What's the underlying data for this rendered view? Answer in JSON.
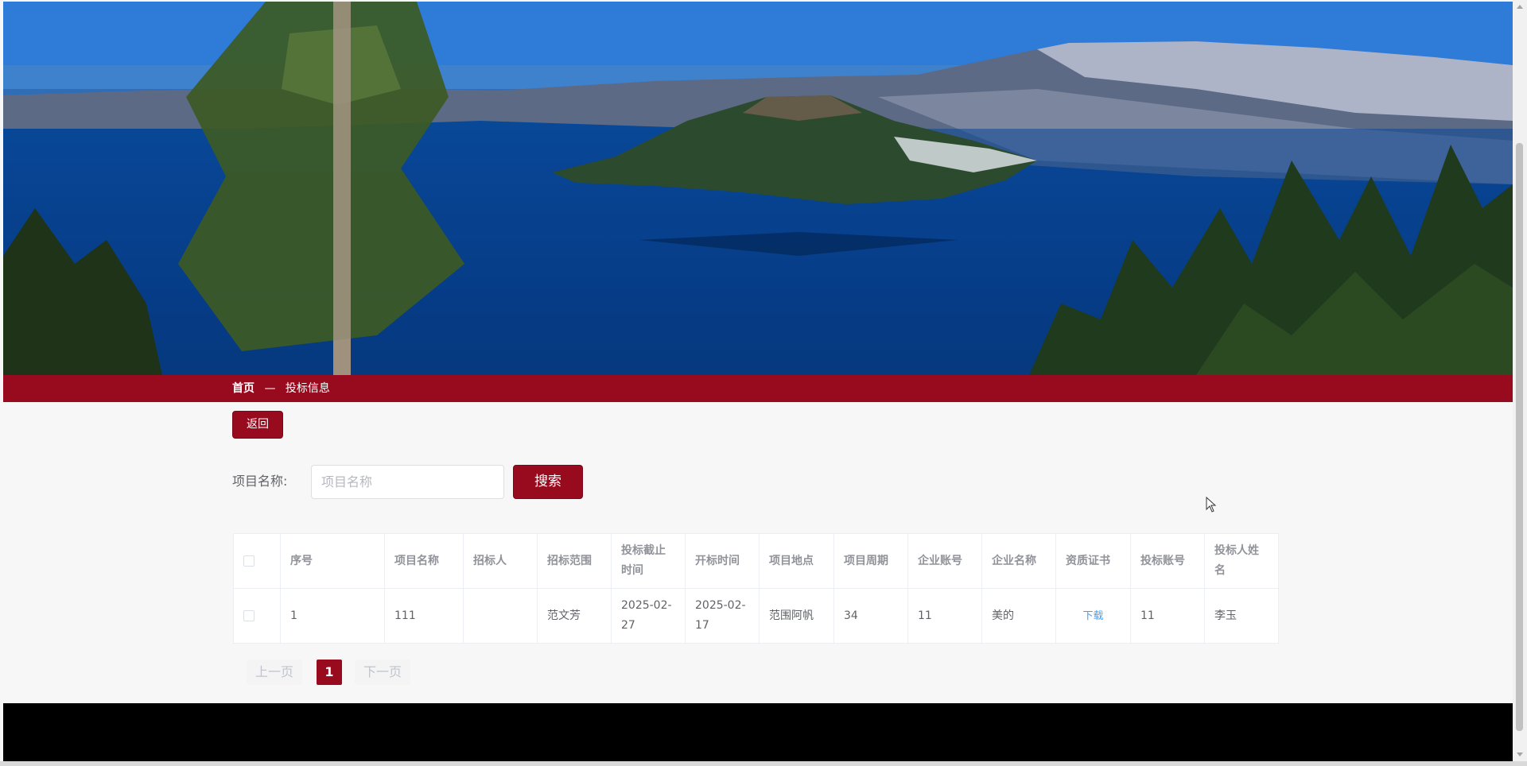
{
  "breadcrumb": {
    "home": "首页",
    "separator": "—",
    "current": "投标信息"
  },
  "actions": {
    "back_label": "返回"
  },
  "search": {
    "label": "项目名称:",
    "placeholder": "项目名称",
    "button_label": "搜索"
  },
  "table": {
    "headers": [
      "序号",
      "项目名称",
      "招标人",
      "招标范围",
      "投标截止时间",
      "开标时间",
      "项目地点",
      "项目周期",
      "企业账号",
      "企业名称",
      "资质证书",
      "投标账号",
      "投标人姓名"
    ],
    "rows": [
      {
        "index": "1",
        "project_name": "111",
        "tenderer": "",
        "scope": "范文芳",
        "deadline": "2025-02-27",
        "open_time": "2025-02-17",
        "location": "范围阿帆",
        "period": "34",
        "company_account": "11",
        "company_name": "美的",
        "certificate": "下载",
        "bid_account": "11",
        "bidder_name": "李玉"
      }
    ]
  },
  "pagination": {
    "prev_label": "上一页",
    "current_page": "1",
    "next_label": "下一页"
  },
  "colors": {
    "brand": "#980a1e",
    "link": "#409eff",
    "footer": "#000000"
  },
  "icons": [
    "mouse-cursor-icon",
    "scroll-up-arrow-icon",
    "scroll-down-arrow-icon"
  ]
}
